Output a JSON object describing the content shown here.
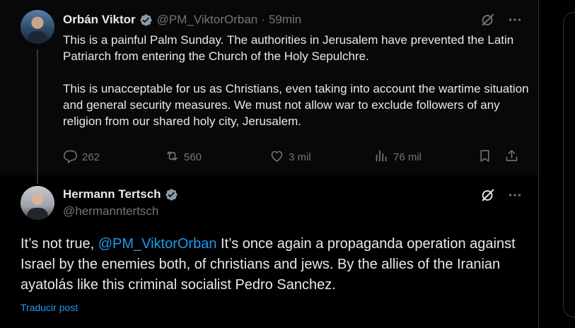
{
  "parent_tweet": {
    "name": "Orbán Viktor",
    "handle": "@PM_ViktorOrban",
    "separator": "·",
    "time": "59min",
    "paragraph_1": "This is a painful Palm Sunday. The authorities in Jerusalem have prevented the Latin Patriarch from entering the Church of the Holy Sepulchre.",
    "paragraph_2": "This is unacceptable for us as Christians, even taking into account the wartime situation and general security measures. We must not allow war to exclude followers of any religion from our shared holy city, Jerusalem.",
    "replies": "262",
    "reposts": "560",
    "likes": "3 mil",
    "views": "76 mil"
  },
  "reply_tweet": {
    "name": "Hermann Tertsch",
    "handle": "@hermanntertsch",
    "text_before": "It’s not true, ",
    "mention": "@PM_ViktorOrban",
    "text_after": " It’s once again a propaganda operation against Israel by the enemies both, of christians  and jews. By the allies of the Iranian ayatolás like this criminal socialist Pedro Sanchez.",
    "translate_label": "Traducir post"
  },
  "colors": {
    "accent": "#1d9bf0",
    "muted": "#71767b",
    "text": "#e7e9ea",
    "background": "#000000"
  },
  "icons": [
    "verified-badge-icon",
    "grok-icon",
    "more-icon",
    "reply-icon",
    "repost-icon",
    "like-icon",
    "views-icon",
    "bookmark-icon",
    "share-icon"
  ]
}
